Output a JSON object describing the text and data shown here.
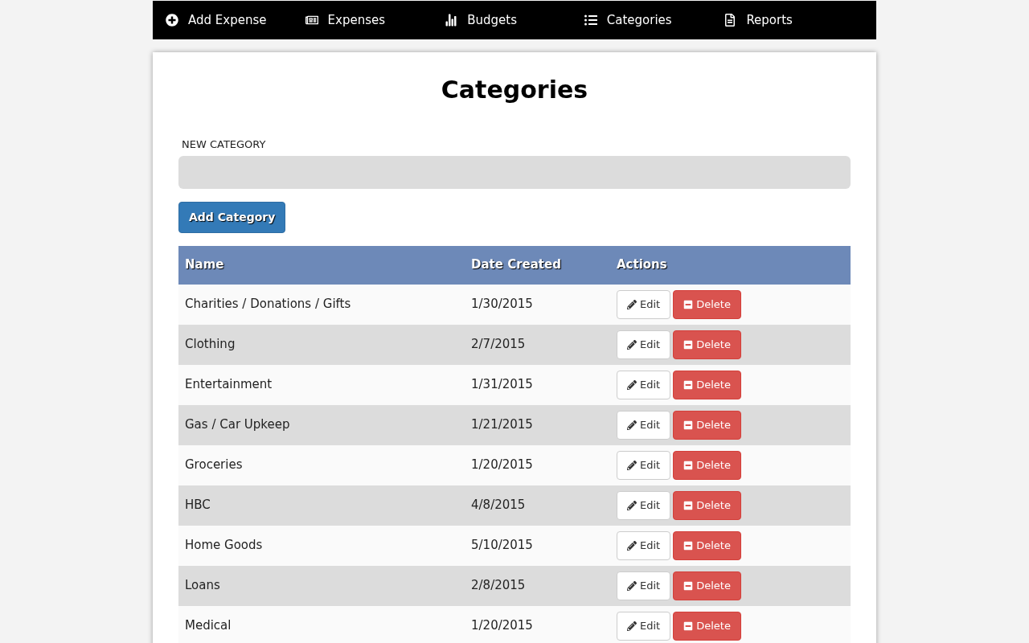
{
  "nav": [
    {
      "label": "Add Expense"
    },
    {
      "label": "Expenses"
    },
    {
      "label": "Budgets"
    },
    {
      "label": "Categories"
    },
    {
      "label": "Reports"
    }
  ],
  "title": "Categories",
  "form": {
    "label": "NEW CATEGORY",
    "button": "Add Category"
  },
  "table": {
    "columns": [
      "Name",
      "Date Created",
      "Actions"
    ],
    "rows": [
      {
        "name": "Charities / Donations / Gifts",
        "date": "1/30/2015",
        "edit": "Edit",
        "delete": "Delete"
      },
      {
        "name": "Clothing",
        "date": "2/7/2015",
        "edit": "Edit",
        "delete": "Delete"
      },
      {
        "name": "Entertainment",
        "date": "1/31/2015",
        "edit": "Edit",
        "delete": "Delete"
      },
      {
        "name": "Gas / Car Upkeep",
        "date": "1/21/2015",
        "edit": "Edit",
        "delete": "Delete"
      },
      {
        "name": "Groceries",
        "date": "1/20/2015",
        "edit": "Edit",
        "delete": "Delete"
      },
      {
        "name": "HBC",
        "date": "4/8/2015",
        "edit": "Edit",
        "delete": "Delete"
      },
      {
        "name": "Home Goods",
        "date": "5/10/2015",
        "edit": "Edit",
        "delete": "Delete"
      },
      {
        "name": "Loans",
        "date": "2/8/2015",
        "edit": "Edit",
        "delete": "Delete"
      },
      {
        "name": "Medical",
        "date": "1/20/2015",
        "edit": "Edit",
        "delete": "Delete"
      }
    ]
  }
}
